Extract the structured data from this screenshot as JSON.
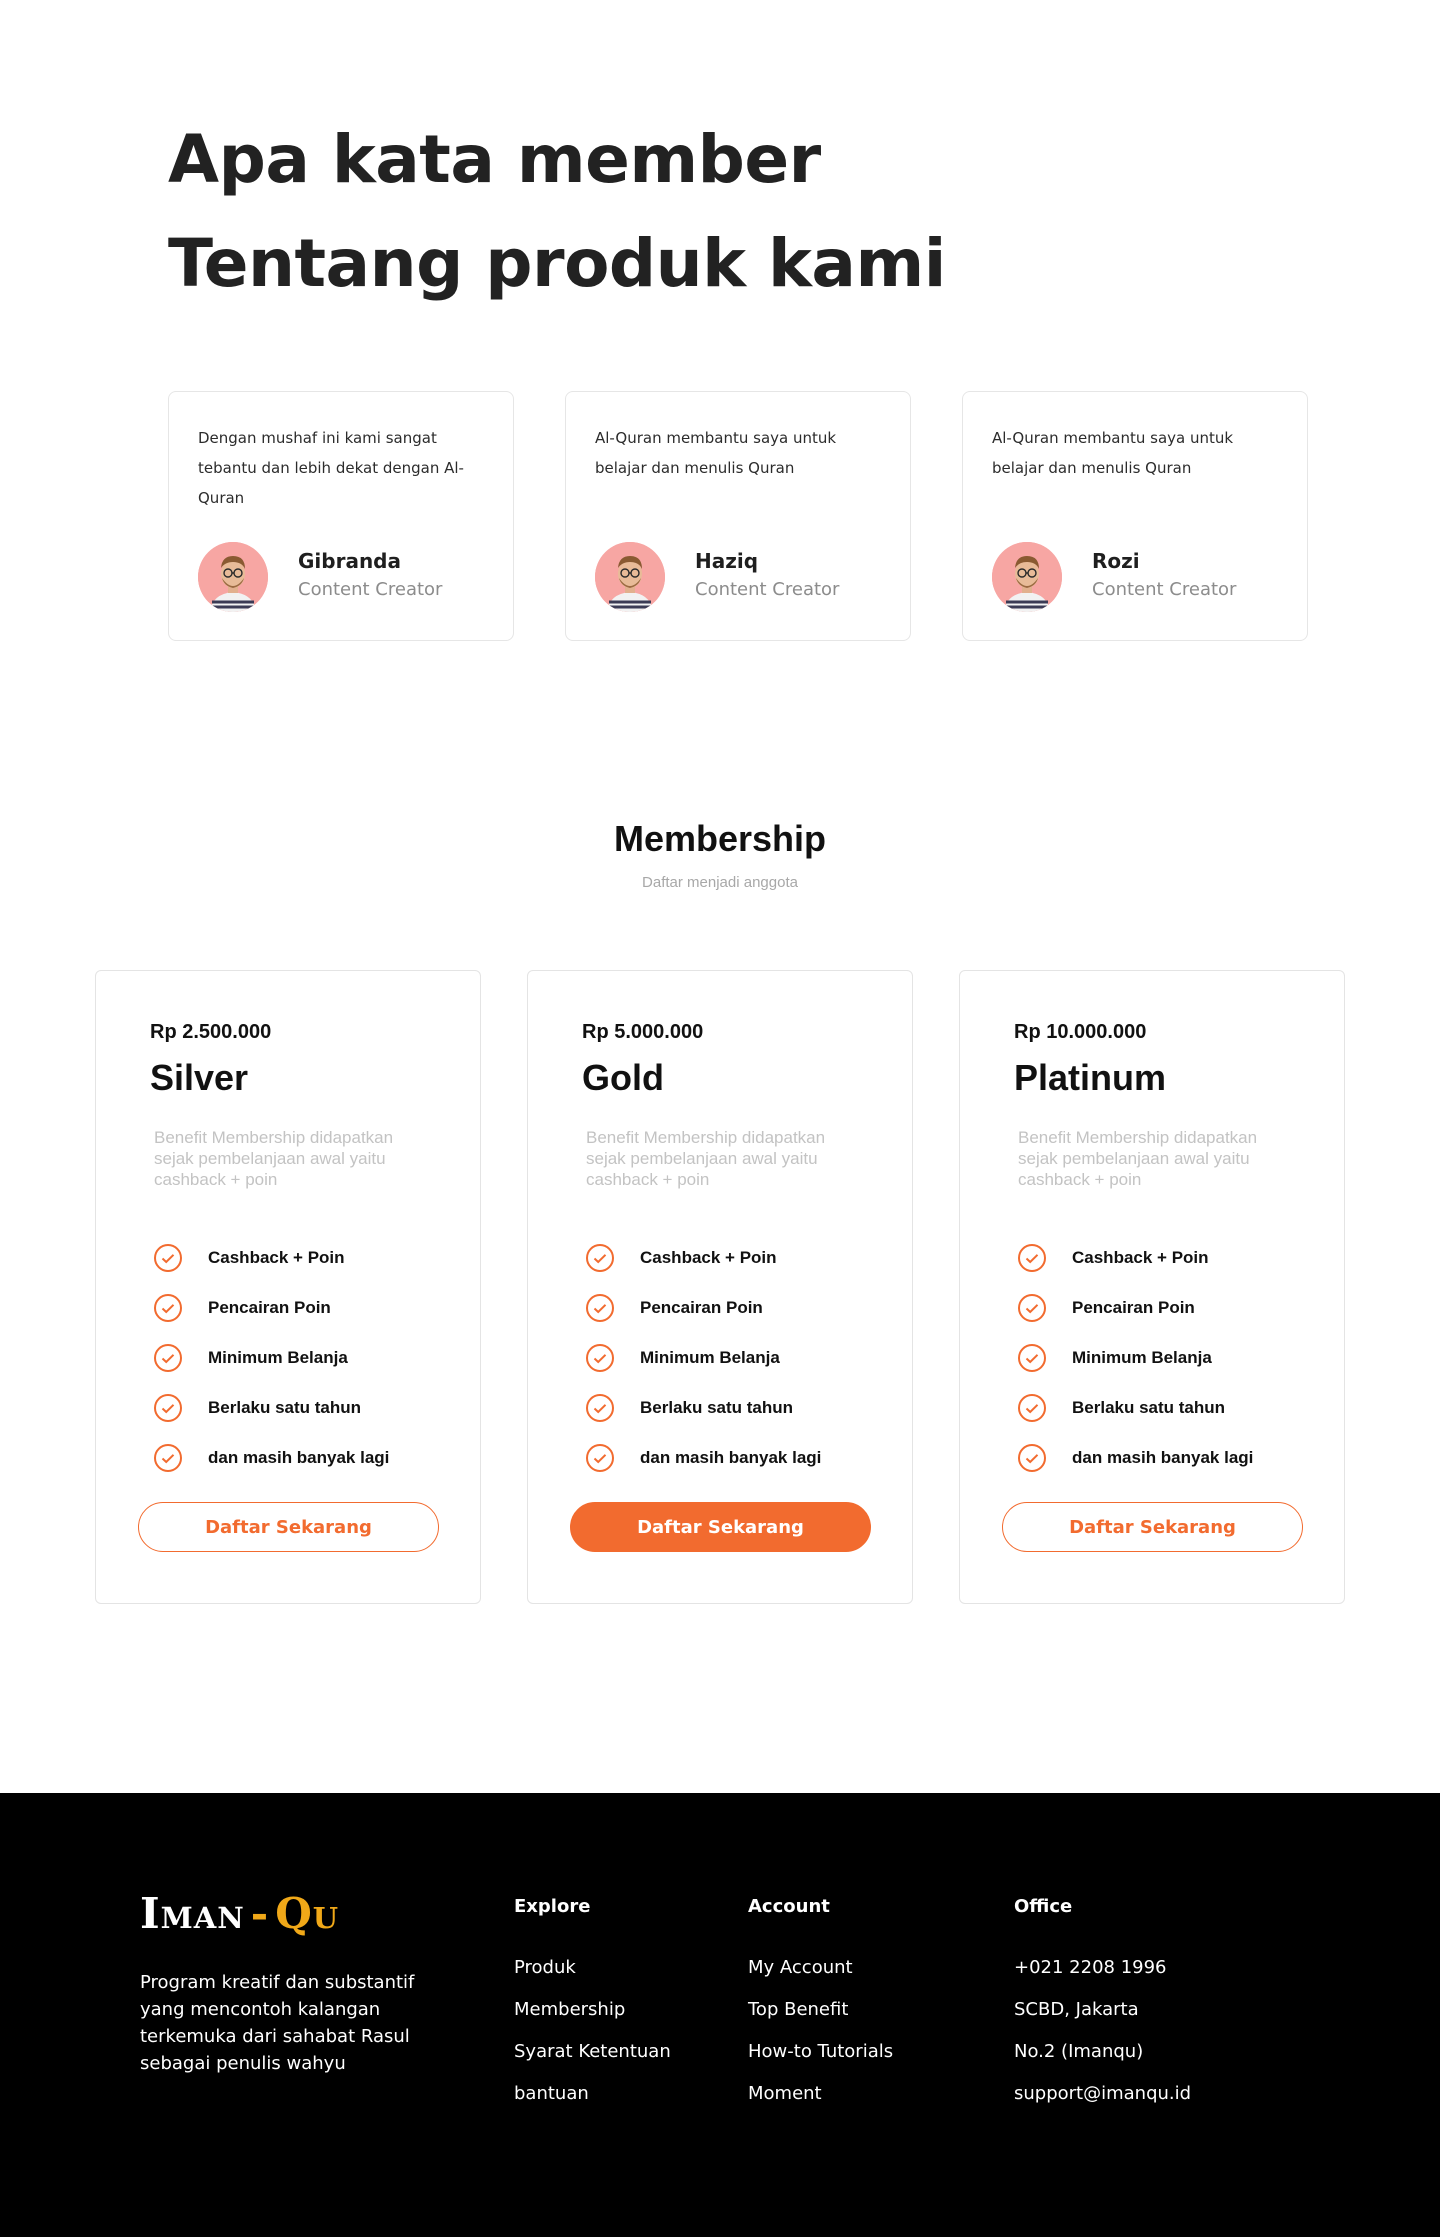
{
  "testimonials": {
    "title_line1": "Apa kata member",
    "title_line2": "Tentang produk kami",
    "items": [
      {
        "text": "Dengan mushaf ini kami sangat tebantu dan lebih dekat dengan Al-Quran",
        "name": "Gibranda",
        "role": "Content Creator"
      },
      {
        "text": "Al-Quran membantu saya untuk belajar dan menulis Quran",
        "name": "Haziq",
        "role": "Content Creator"
      },
      {
        "text": "Al-Quran membantu saya untuk belajar dan menulis Quran",
        "name": "Rozi",
        "role": "Content Creator"
      }
    ]
  },
  "membership": {
    "title": "Membership",
    "subtitle": "Daftar menjadi anggota",
    "plans": [
      {
        "price": "Rp 2.500.000",
        "name": "Silver",
        "description": "Benefit Membership didapatkan sejak pembelanjaan awal yaitu cashback + poin",
        "features": [
          "Cashback + Poin",
          "Pencairan Poin",
          "Minimum Belanja",
          "Berlaku satu tahun",
          "dan masih banyak lagi"
        ],
        "button": "Daftar Sekarang"
      },
      {
        "price": "Rp 5.000.000",
        "name": "Gold",
        "description": "Benefit Membership didapatkan sejak pembelanjaan awal yaitu cashback + poin",
        "features": [
          "Cashback + Poin",
          "Pencairan Poin",
          "Minimum Belanja",
          "Berlaku satu tahun",
          "dan masih banyak lagi"
        ],
        "button": "Daftar Sekarang"
      },
      {
        "price": "Rp 10.000.000",
        "name": "Platinum",
        "description": "Benefit Membership didapatkan sejak pembelanjaan awal yaitu cashback + poin",
        "features": [
          "Cashback + Poin",
          "Pencairan Poin",
          "Minimum Belanja",
          "Berlaku satu tahun",
          "dan masih banyak lagi"
        ],
        "button": "Daftar Sekarang"
      }
    ]
  },
  "footer": {
    "logo_part1": "Iman",
    "logo_dash": "-",
    "logo_part2": "Qu",
    "about": "Program kreatif dan substantif yang mencontoh kalangan terkemuka dari sahabat Rasul sebagai penulis wahyu",
    "explore": {
      "heading": "Explore",
      "links": [
        "Produk",
        "Membership",
        "Syarat Ketentuan",
        "bantuan"
      ]
    },
    "account": {
      "heading": "Account",
      "links": [
        "My Account",
        "Top Benefit",
        "How-to Tutorials",
        "Moment"
      ]
    },
    "office": {
      "heading": "Office",
      "links": [
        "+021 2208 1996",
        "SCBD, Jakarta",
        "No.2 (Imanqu)",
        "support@imanqu.id"
      ]
    }
  },
  "colors": {
    "accent": "#f26b2f",
    "logo_gold": "#f0a818",
    "footer_bg": "#000000",
    "avatar_bg": "#f7a6a3"
  },
  "icons": {
    "feature_check": "check-circle-icon",
    "avatar": "person-avatar-icon"
  }
}
